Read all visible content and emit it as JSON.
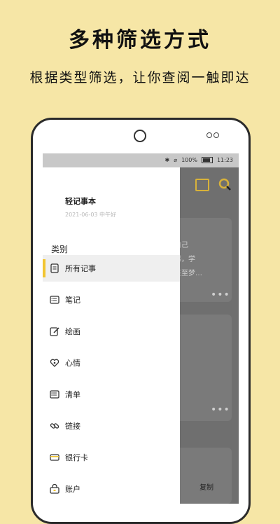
{
  "promo": {
    "headline": "多种筛选方式",
    "subline": "根据类型筛选，让你查阅一触即达"
  },
  "status_bar": {
    "battery": "100%",
    "time": "11:23"
  },
  "drawer": {
    "app_title": "轻记事本",
    "date_greeting": "2021-06-03 中午好",
    "section_title": "类别",
    "items": [
      {
        "label": "所有记事",
        "icon": "note-list-icon",
        "active": true
      },
      {
        "label": "笔记",
        "icon": "notebook-icon"
      },
      {
        "label": "绘画",
        "icon": "pencil-icon"
      },
      {
        "label": "心情",
        "icon": "heart-icon"
      },
      {
        "label": "清单",
        "icon": "checklist-icon"
      },
      {
        "label": "链接",
        "icon": "link-icon"
      },
      {
        "label": "银行卡",
        "icon": "bank-card-icon"
      },
      {
        "label": "账户",
        "icon": "account-icon"
      }
    ]
  },
  "background_app": {
    "card_text_line1": "以为自己",
    "card_text_line2": "较敏感，学",
    "card_text_line3": "就，甚至梦…",
    "more": "•••",
    "copy_label": "复制"
  },
  "colors": {
    "page_background": "#f6e6a6",
    "accent": "#f2c531"
  }
}
